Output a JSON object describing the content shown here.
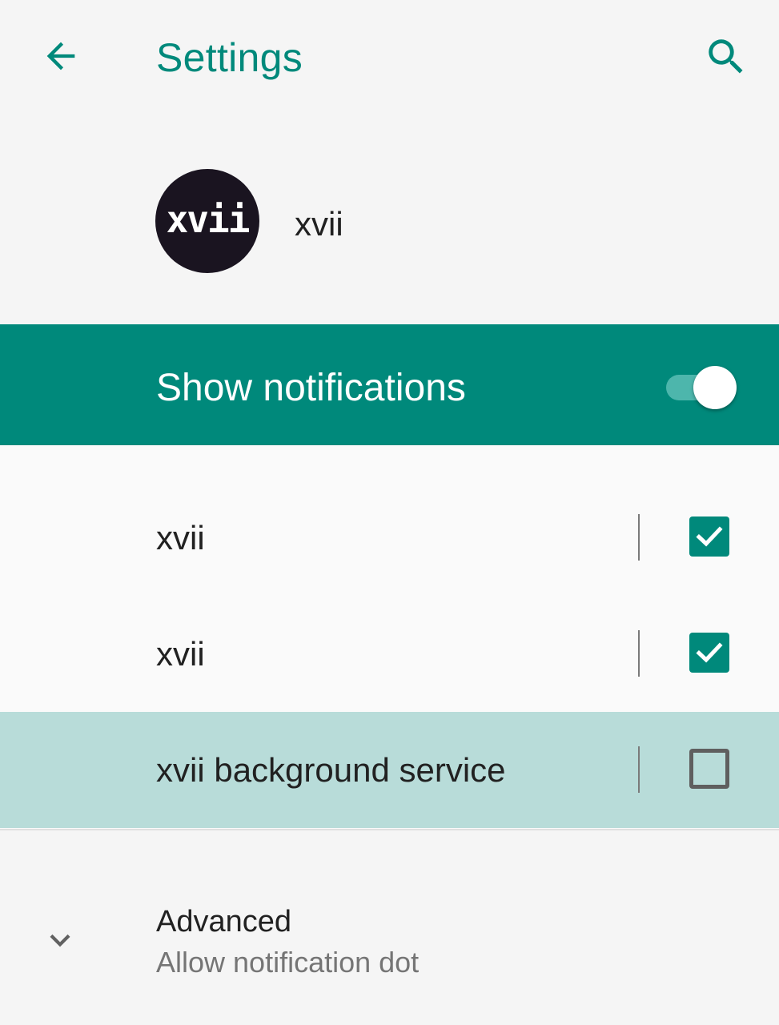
{
  "app_bar": {
    "title": "Settings",
    "back_icon": "arrow-back-icon",
    "search_icon": "search-icon"
  },
  "app_header": {
    "icon_text": "xvii",
    "app_name": "xvii"
  },
  "master_toggle": {
    "label": "Show notifications",
    "enabled": true
  },
  "channels": [
    {
      "label": "xvii",
      "checked": true,
      "highlighted": false
    },
    {
      "label": "xvii",
      "checked": true,
      "highlighted": false
    },
    {
      "label": "xvii background service",
      "checked": false,
      "highlighted": true
    }
  ],
  "advanced": {
    "title": "Advanced",
    "subtitle": "Allow notification dot",
    "expand_icon": "chevron-down-icon"
  },
  "colors": {
    "accent": "#00897b",
    "accent_light": "#4db6ac",
    "highlight_row": "#b8dcd9",
    "background": "#f5f5f5",
    "text_primary": "#212121",
    "text_secondary": "#757575"
  }
}
